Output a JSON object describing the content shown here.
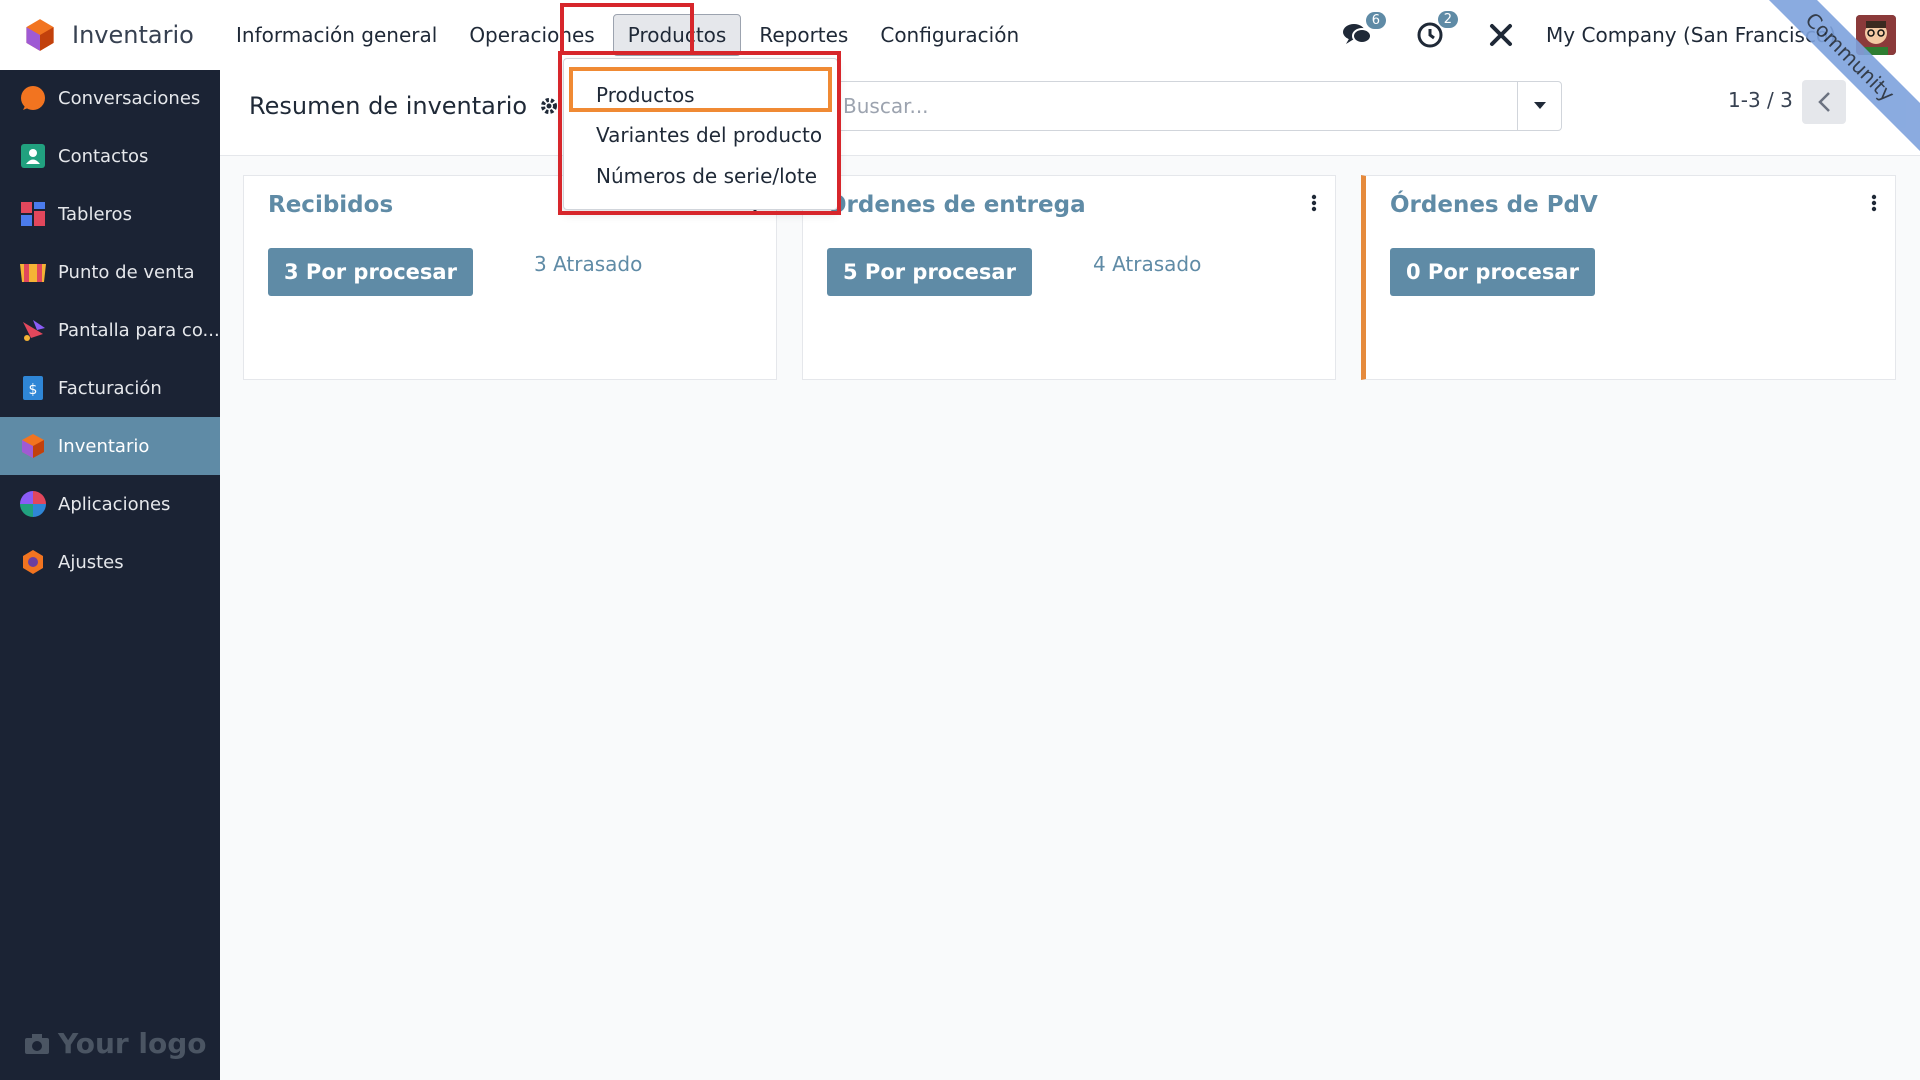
{
  "app": {
    "name": "Inventario"
  },
  "menu": [
    {
      "label": "Información general"
    },
    {
      "label": "Operaciones"
    },
    {
      "label": "Productos"
    },
    {
      "label": "Reportes"
    },
    {
      "label": "Configuración"
    }
  ],
  "nav_right": {
    "messages_count": "6",
    "activities_count": "2",
    "company": "My Company (San Francisco)"
  },
  "ribbon": "Community",
  "sidebar": {
    "items": [
      {
        "label": "Conversaciones",
        "icon": "chat-bubble-icon"
      },
      {
        "label": "Contactos",
        "icon": "contact-card-icon"
      },
      {
        "label": "Tableros",
        "icon": "dashboard-grid-icon"
      },
      {
        "label": "Punto de venta",
        "icon": "storefront-icon"
      },
      {
        "label": "Pantalla para co...",
        "icon": "display-hand-icon"
      },
      {
        "label": "Facturación",
        "icon": "invoice-dollar-icon"
      },
      {
        "label": "Inventario",
        "icon": "inventory-cube-icon",
        "active": true
      },
      {
        "label": "Aplicaciones",
        "icon": "apps-circle-icon"
      },
      {
        "label": "Ajustes",
        "icon": "settings-gear-icon"
      }
    ],
    "logo_text": "Your logo"
  },
  "control": {
    "title": "Resumen de inventario",
    "search_placeholder": "Buscar...",
    "pager": "1-3 / 3"
  },
  "dropdown": {
    "items": [
      {
        "label": "Productos"
      },
      {
        "label": "Variantes del producto"
      },
      {
        "label": "Números de serie/lote"
      }
    ]
  },
  "cards": [
    {
      "title": "Recibidos",
      "button": "3 Por procesar",
      "late": "3 Atrasado"
    },
    {
      "title": "Órdenes de entrega",
      "button": "5 Por procesar",
      "late": "4 Atrasado"
    },
    {
      "title": "Órdenes de PdV",
      "button": "0 Por procesar",
      "late": ""
    }
  ],
  "colors": {
    "primary": "#5f8ba6",
    "sidebar_bg": "#1b2334",
    "accent_orange": "#e58a3c",
    "highlight_red": "#d7262b",
    "highlight_orange": "#f08a34"
  }
}
